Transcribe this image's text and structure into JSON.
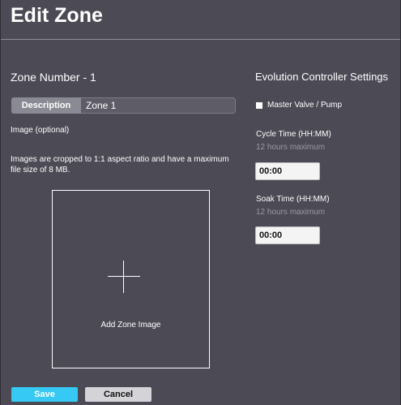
{
  "page": {
    "title": "Edit Zone",
    "zone_number": "Zone Number - 1"
  },
  "description": {
    "label": "Description",
    "value": "Zone 1"
  },
  "image": {
    "label": "Image (optional)",
    "help_text": "Images are cropped to 1:1 aspect ratio and have a maximum file size of 8 MB.",
    "add_label": "Add Zone Image"
  },
  "controller": {
    "title": "Evolution Controller Settings",
    "master_valve_label": "Master Valve / Pump",
    "master_valve_checked": false,
    "cycle_time": {
      "label": "Cycle Time (HH:MM)",
      "hint": "12 hours maximum",
      "value": "00:00"
    },
    "soak_time": {
      "label": "Soak Time (HH:MM)",
      "hint": "12 hours maximum",
      "value": "00:00"
    }
  },
  "actions": {
    "save_label": "Save",
    "cancel_label": "Cancel"
  },
  "colors": {
    "panel_background": "#4b4a55",
    "save_button": "#35c9f4",
    "cancel_button": "#d4d4d8"
  },
  "icons": {
    "add_image": "plus-icon"
  }
}
